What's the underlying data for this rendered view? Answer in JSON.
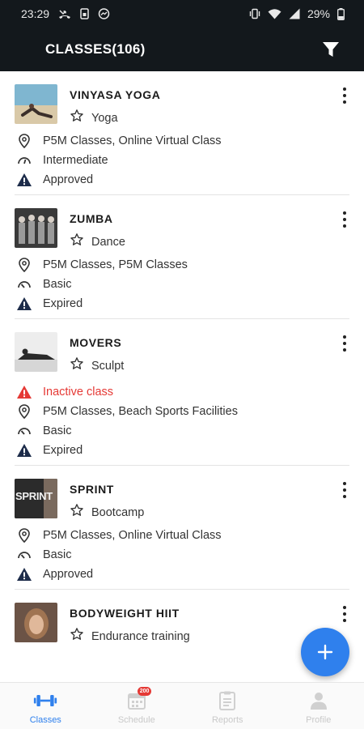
{
  "status_bar": {
    "time": "23:29",
    "battery": "29%"
  },
  "header": {
    "title": "CLASSES(106)",
    "filter_icon": "filter-funnel-icon"
  },
  "classes": [
    {
      "name": "VINYASA YOGA",
      "category": "Yoga",
      "location": "P5M Classes, Online Virtual Class",
      "level": "Intermediate",
      "status": "Approved"
    },
    {
      "name": "ZUMBA",
      "category": "Dance",
      "location": "P5M Classes, P5M Classes",
      "level": "Basic",
      "status": "Expired"
    },
    {
      "name": "MOVERS",
      "category": "Sculpt",
      "warning": "Inactive class",
      "location": "P5M Classes, Beach Sports Facilities",
      "level": "Basic",
      "status": "Expired"
    },
    {
      "name": "SPRINT",
      "category": "Bootcamp",
      "thumb_text": "SPRINT",
      "location": "P5M Classes, Online Virtual Class",
      "level": "Basic",
      "status": "Approved"
    },
    {
      "name": "BODYWEIGHT HIIT",
      "category": "Endurance training"
    }
  ],
  "fab": {
    "icon": "plus-icon"
  },
  "bottom_nav": {
    "items": [
      {
        "label": "Classes",
        "icon": "dumbbell-icon",
        "active": true
      },
      {
        "label": "Schedule",
        "icon": "calendar-icon",
        "badge": "200"
      },
      {
        "label": "Reports",
        "icon": "clipboard-icon"
      },
      {
        "label": "Profile",
        "icon": "person-icon"
      }
    ]
  },
  "colors": {
    "header_bg": "#13181c",
    "accent": "#2f80ed",
    "warning": "#e53935",
    "status_icon": "#1d2c4a"
  }
}
